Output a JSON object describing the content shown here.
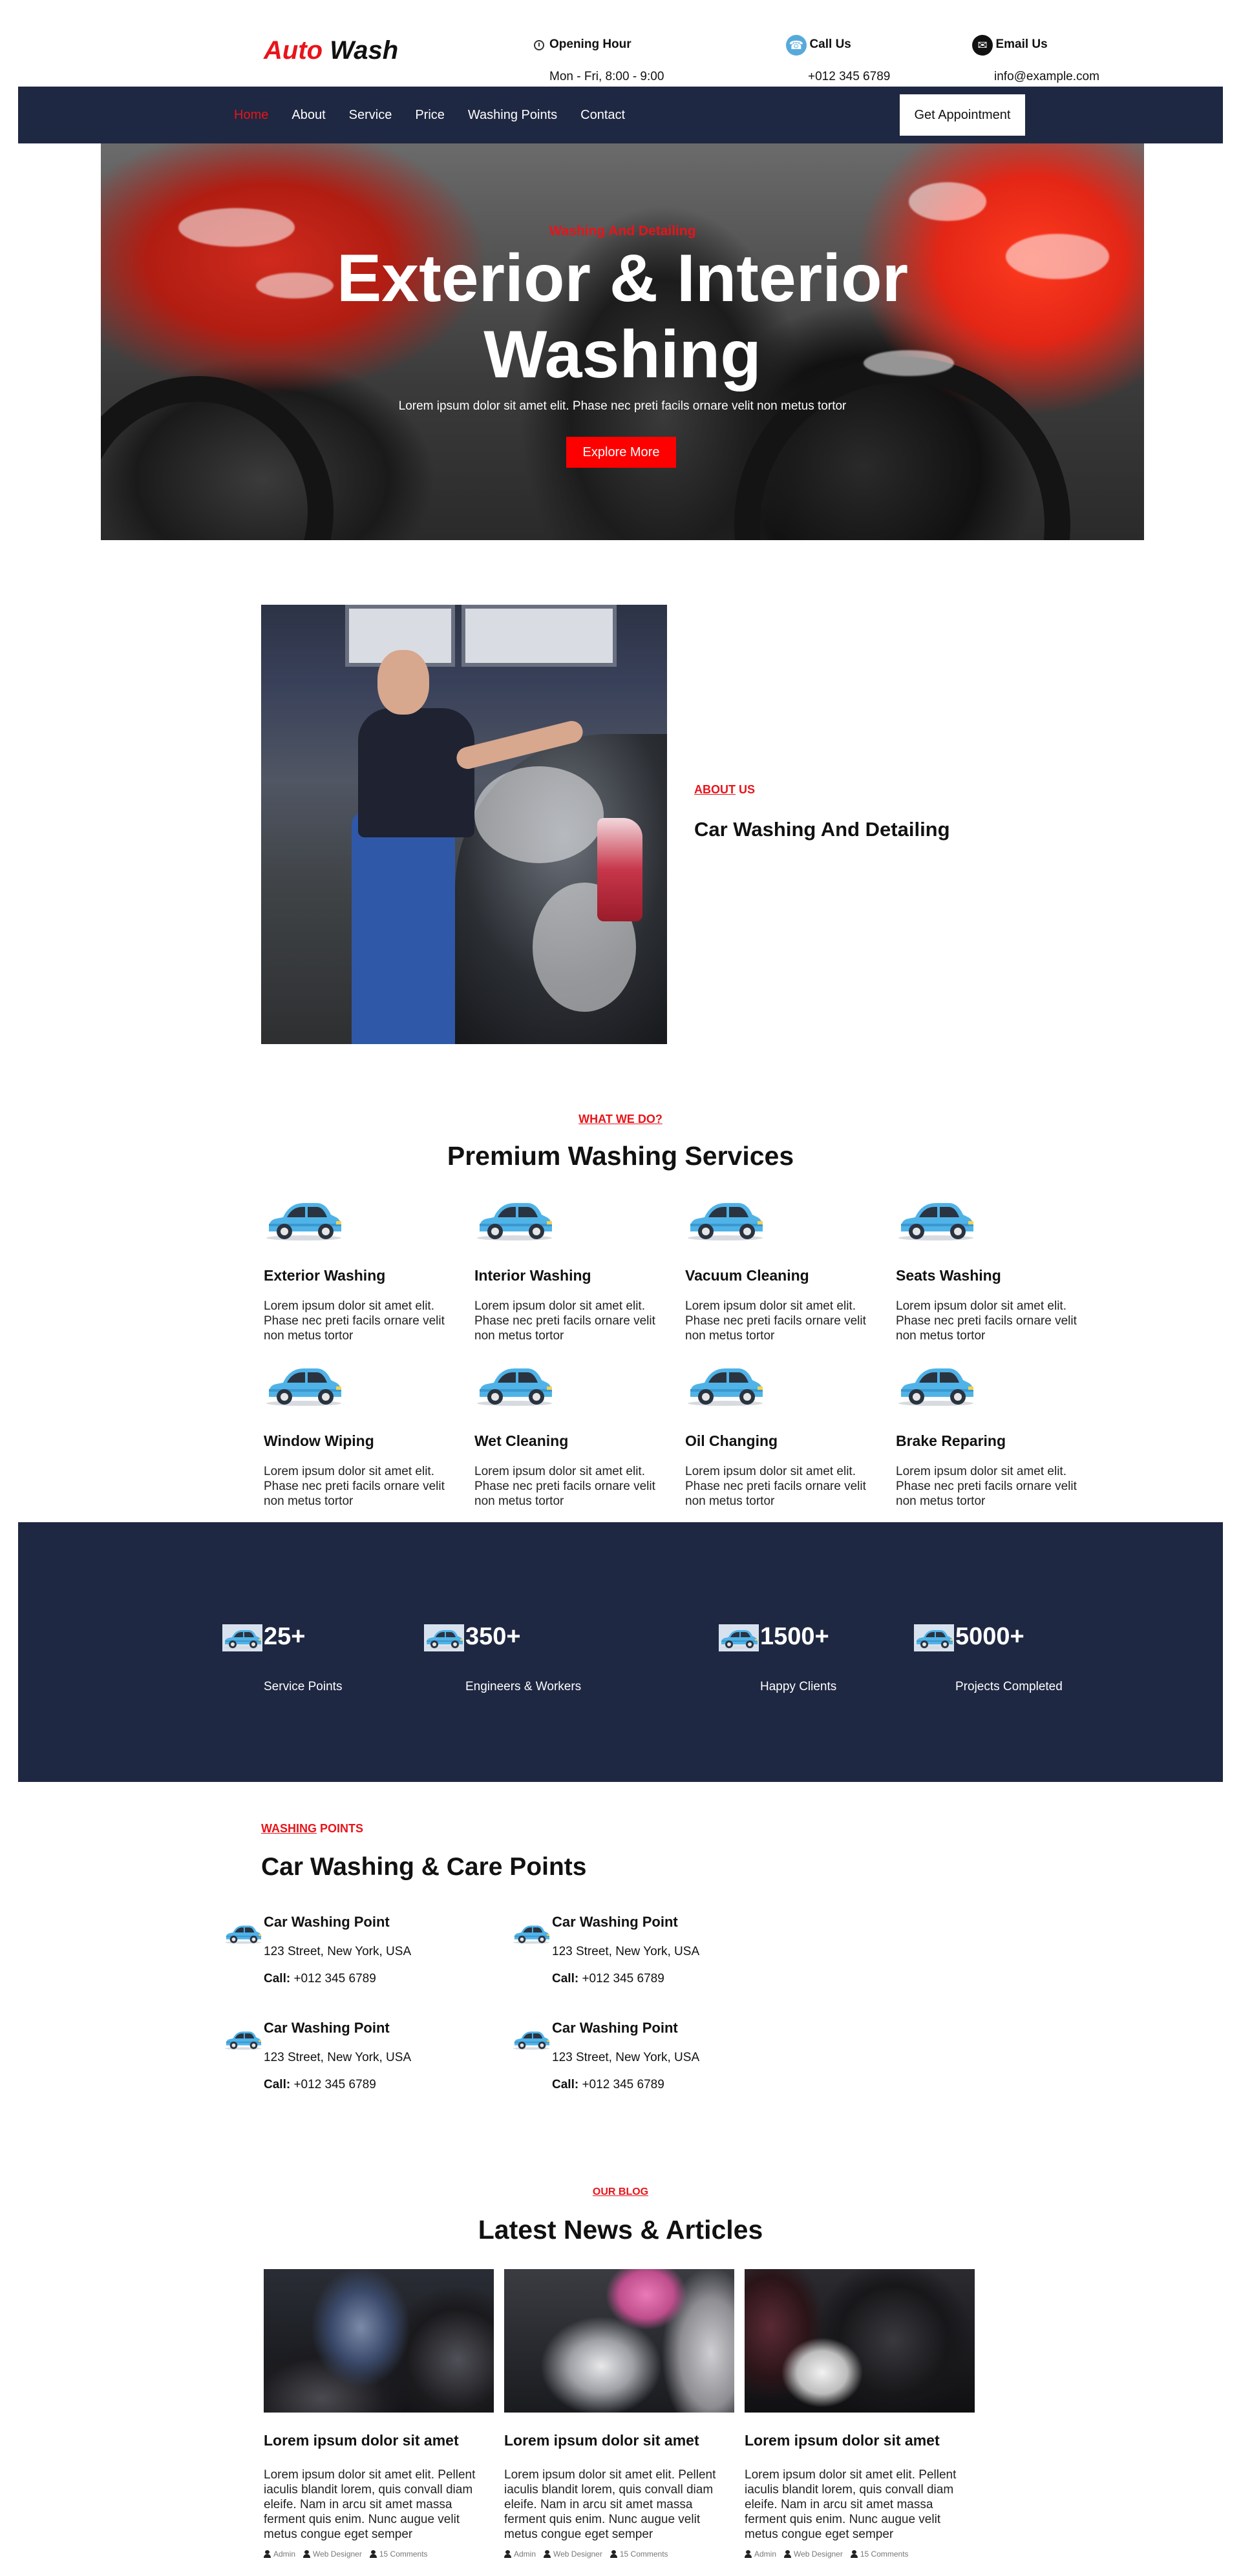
{
  "brand": {
    "part1": "Auto",
    "part2": "Wash"
  },
  "topbar": {
    "opening": {
      "title": "Opening Hour",
      "value": "Mon - Fri, 8:00 - 9:00"
    },
    "call": {
      "title": "Call Us",
      "value": "+012 345 6789"
    },
    "email": {
      "title": "Email Us",
      "value": "info@example.com"
    }
  },
  "nav": {
    "items": [
      "Home",
      "About",
      "Service",
      "Price",
      "Washing Points",
      "Contact"
    ],
    "cta": "Get Appointment"
  },
  "hero": {
    "subtitle": "Washing And Detailing",
    "title_line1": "Exterior & Interior",
    "title_line2": "Washing",
    "text": "Lorem ipsum dolor sit amet elit. Phase nec preti facils ornare velit non metus tortor",
    "button": "Explore More"
  },
  "about": {
    "tag_a": "ABOUT",
    "tag_b": " US",
    "title": "Car Washing And Detailing"
  },
  "services": {
    "tag": "WHAT WE DO?",
    "title": "Premium Washing Services",
    "items": [
      {
        "title": "Exterior Washing",
        "text": "Lorem ipsum dolor sit amet elit. Phase nec preti facils ornare velit non metus tortor"
      },
      {
        "title": "Interior Washing",
        "text": "Lorem ipsum dolor sit amet elit. Phase nec preti facils ornare velit non metus tortor"
      },
      {
        "title": "Vacuum Cleaning",
        "text": "Lorem ipsum dolor sit amet elit. Phase nec preti facils ornare velit non metus tortor"
      },
      {
        "title": "Seats Washing",
        "text": "Lorem ipsum dolor sit amet elit. Phase nec preti facils ornare velit non metus tortor"
      },
      {
        "title": "Window Wiping",
        "text": "Lorem ipsum dolor sit amet elit. Phase nec preti facils ornare velit non metus tortor"
      },
      {
        "title": "Wet Cleaning",
        "text": "Lorem ipsum dolor sit amet elit. Phase nec preti facils ornare velit non metus tortor"
      },
      {
        "title": "Oil Changing",
        "text": "Lorem ipsum dolor sit amet elit. Phase nec preti facils ornare velit non metus tortor"
      },
      {
        "title": "Brake Reparing",
        "text": "Lorem ipsum dolor sit amet elit. Phase nec preti facils ornare velit non metus tortor"
      }
    ]
  },
  "stats": [
    {
      "value": "25+",
      "label": "Service Points"
    },
    {
      "value": "350+",
      "label": "Engineers & Workers"
    },
    {
      "value": "1500+",
      "label": "Happy Clients"
    },
    {
      "value": "5000+",
      "label": "Projects Completed"
    }
  ],
  "washing_points": {
    "tag_a": "WASHING",
    "tag_b": " POINTS",
    "title": "Car Washing & Care Points",
    "items": [
      {
        "name": "Car Washing Point",
        "address": "123 Street, New York, USA",
        "call_label": "Call:",
        "phone": " +012 345 6789"
      },
      {
        "name": "Car Washing Point",
        "address": "123 Street, New York, USA",
        "call_label": "Call:",
        "phone": " +012 345 6789"
      },
      {
        "name": "Car Washing Point",
        "address": "123 Street, New York, USA",
        "call_label": "Call:",
        "phone": " +012 345 6789"
      },
      {
        "name": "Car Washing Point",
        "address": "123 Street, New York, USA",
        "call_label": "Call:",
        "phone": " +012 345 6789"
      }
    ]
  },
  "blog": {
    "tag": "OUR BLOG",
    "title": "Latest News & Articles",
    "posts": [
      {
        "title": "Lorem ipsum dolor sit amet",
        "text": "Lorem ipsum dolor sit amet elit. Pellent iaculis blandit lorem, quis convall diam eleife. Nam in arcu sit amet massa ferment quis enim. Nunc augue velit metus congue eget semper",
        "author": "Admin",
        "category": "Web Designer",
        "comments": "15 Comments"
      },
      {
        "title": "Lorem ipsum dolor sit amet",
        "text": "Lorem ipsum dolor sit amet elit. Pellent iaculis blandit lorem, quis convall diam eleife. Nam in arcu sit amet massa ferment quis enim. Nunc augue velit metus congue eget semper",
        "author": "Admin",
        "category": "Web Designer",
        "comments": "15 Comments"
      },
      {
        "title": "Lorem ipsum dolor sit amet",
        "text": "Lorem ipsum dolor sit amet elit. Pellent iaculis blandit lorem, quis convall diam eleife. Nam in arcu sit amet massa ferment quis enim. Nunc augue velit metus congue eget semper",
        "author": "Admin",
        "category": "Web Designer",
        "comments": "15 Comments"
      }
    ]
  },
  "colors": {
    "accent": "#e8141a",
    "navy": "#1f2842",
    "car_icon": "#4fb3e8"
  }
}
